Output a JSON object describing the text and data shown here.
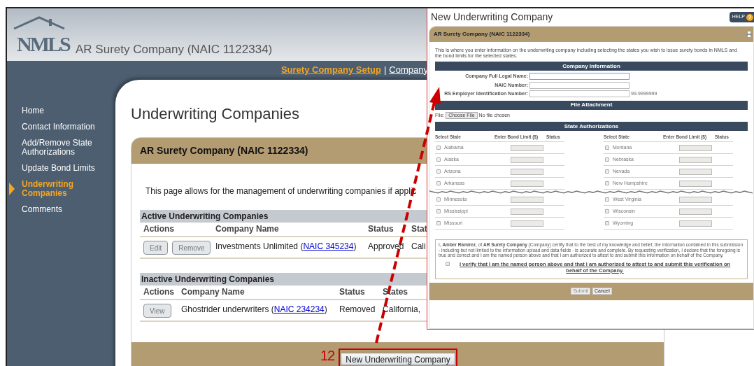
{
  "header": {
    "logo": "NMLS",
    "title": "AR Surety Company (NAIC 1122334)"
  },
  "nav_links": [
    {
      "label": "Surety Company Setup",
      "selected": true
    },
    {
      "label": "Company",
      "selected": false
    }
  ],
  "nav_separator": "|",
  "sidebar": {
    "items": [
      {
        "label": "Home",
        "selected": false
      },
      {
        "label": "Contact Information",
        "selected": false
      },
      {
        "label": "Add/Remove State Authorizations",
        "selected": false
      },
      {
        "label": "Update Bond Limits",
        "selected": false
      },
      {
        "label": "Underwriting Companies",
        "selected": true
      },
      {
        "label": "Comments",
        "selected": false
      }
    ]
  },
  "page_title": "Underwriting Companies",
  "card": {
    "title": "AR Surety Company (NAIC 1122334)",
    "intro": "This page allows for the management of underwriting companies if applic",
    "sections": [
      {
        "title": "Active Underwriting Companies",
        "columns": [
          "Actions",
          "Company Name",
          "Status",
          "Stat"
        ],
        "rows": [
          {
            "actions": [
              "Edit",
              "Remove"
            ],
            "company": {
              "before": "Investments Unlimited (",
              "link": "NAIC 345234",
              "after": ")"
            },
            "status": "Approved",
            "states": "Cali"
          }
        ]
      },
      {
        "title": "Inactive Underwriting Companies",
        "columns": [
          "Actions",
          "Company Name",
          "Status",
          "States"
        ],
        "rows": [
          {
            "actions": [
              "View"
            ],
            "company": {
              "before": "Ghostrider underwriters (",
              "link": "NAIC 234234",
              "after": ")"
            },
            "status": "Removed",
            "states": "California,"
          }
        ]
      }
    ],
    "step": "12",
    "button": "New Underwriting Company"
  },
  "dialog": {
    "title": "New Underwriting Company",
    "help": "HELP",
    "help_icon": "?",
    "header": "AR Surety Company (NAIC 1122334)",
    "intro": "This is where you enter information on the underwriting company including selecting the states you wish to issue surety bonds in NMLS and the bond limits for the selected states.",
    "company_info": {
      "title": "Company Information",
      "fields": [
        {
          "label": "Company Full Legal Name:",
          "focused": true
        },
        {
          "label": "NAIC Number:",
          "focused": false
        },
        {
          "label": "RS Employer Identification Number:",
          "focused": false,
          "hint": "99-9999999"
        }
      ]
    },
    "file_attachment": {
      "title": "File Attachment",
      "label": "File:",
      "button": "Choose File",
      "status": "No file chosen"
    },
    "states": {
      "title": "State Authorizations",
      "columns": [
        [
          "Select State",
          "Enter Bond Limit ($)",
          "Status"
        ],
        [
          "Select State",
          "Enter Bond Limit ($)",
          "Status"
        ]
      ],
      "rows_above_tear": [
        {
          "left": {
            "name": "Alabama",
            "checked": false
          },
          "right": {
            "name": "Montana",
            "checked": false
          }
        },
        {
          "left": {
            "name": "Alaska",
            "checked": false
          },
          "right": {
            "name": "Nebraska",
            "checked": false
          }
        },
        {
          "left": {
            "name": "Arizona",
            "checked": false
          },
          "right": {
            "name": "Nevada",
            "checked": false
          }
        },
        {
          "left": {
            "name": "Arkansas",
            "checked": false
          },
          "right": {
            "name": "New Hampshire",
            "checked": false
          }
        }
      ],
      "rows_below_tear": [
        {
          "left": {
            "name": "Minnesota",
            "checked": false
          },
          "right": {
            "name": "West Virginia",
            "checked": false
          }
        },
        {
          "left": {
            "name": "Mississippi",
            "checked": false
          },
          "right": {
            "name": "Wisconsin",
            "checked": false
          }
        },
        {
          "left": {
            "name": "Missouri",
            "checked": false
          },
          "right": {
            "name": "Wyoming",
            "checked": false
          }
        }
      ]
    },
    "certification": "I, **Amber Ramirez**, of **AR Surety Company** (Company) certify that to the best of my knowledge and belief, the information contained in this submission - including but not limited to the information upload and data fields - is accurate and complete. By requesting verification, I declare that the foregoing is true and correct and I am the named person above and that I am authorized to attest to and submit this information on behalf of the Company.",
    "verify": {
      "label": "I verify that I am the named person above and that I am authorized to attest to and submit this verification on behalf of the Company.",
      "checked": false
    },
    "buttons": [
      {
        "label": "Submit",
        "disabled": true
      },
      {
        "label": "Cancel",
        "disabled": false
      }
    ]
  }
}
